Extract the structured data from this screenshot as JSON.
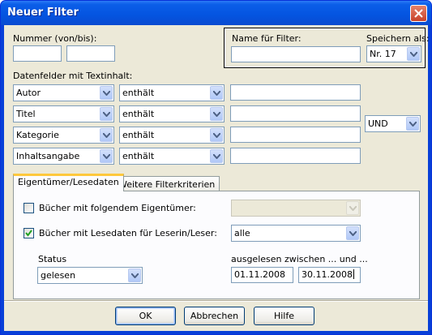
{
  "window": {
    "title": "Neuer Filter"
  },
  "nummer": {
    "label": "Nummer (von/bis):",
    "from": "",
    "to": ""
  },
  "filtername": {
    "label": "Name für Filter:",
    "value": ""
  },
  "speichern": {
    "label": "Speichern als:",
    "value": "Nr. 17"
  },
  "datenfelder": {
    "label": "Datenfelder mit Textinhalt:",
    "rows": [
      {
        "field": "Autor",
        "op": "enthält",
        "value": ""
      },
      {
        "field": "Titel",
        "op": "enthält",
        "value": ""
      },
      {
        "field": "Kategorie",
        "op": "enthält",
        "value": ""
      },
      {
        "field": "Inhaltsangabe",
        "op": "enthält",
        "value": ""
      }
    ],
    "logic": "UND"
  },
  "tabs": [
    "Eigentümer/Lesedaten",
    "Weitere Filterkriterien"
  ],
  "owner": {
    "label": "Bücher mit folgendem Eigentümer:",
    "checked": false,
    "value": ""
  },
  "reader": {
    "label": "Bücher mit Lesedaten für Leserin/Leser:",
    "checked": true,
    "value": "alle"
  },
  "status": {
    "label": "Status",
    "value": "gelesen"
  },
  "gelesen": {
    "label": "ausgelesen zwischen ... und ...",
    "from": "01.11.2008",
    "to": "30.11.2008"
  },
  "buttons": {
    "ok": "OK",
    "cancel": "Abbrechen",
    "help": "Hilfe"
  }
}
